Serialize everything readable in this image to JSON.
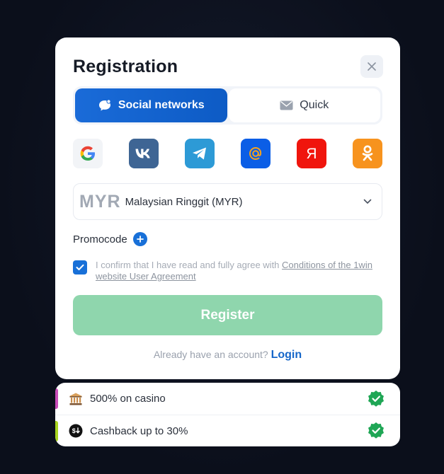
{
  "modal": {
    "title": "Registration",
    "tabs": [
      {
        "label": "Social networks",
        "icon": "chat-bubble-icon",
        "active": true
      },
      {
        "label": "Quick",
        "icon": "envelope-icon",
        "active": false
      }
    ],
    "social_providers": [
      {
        "name": "google-icon",
        "color": "#f2f4f7"
      },
      {
        "name": "vk-icon",
        "color": "#3e6594"
      },
      {
        "name": "telegram-icon",
        "color": "#2d9ad6"
      },
      {
        "name": "mail-at-icon",
        "color": "#0b5ee6"
      },
      {
        "name": "yandex-icon",
        "color": "#f0150d",
        "glyph": "Я"
      },
      {
        "name": "odnoklassniki-icon",
        "color": "#f7931e"
      }
    ],
    "currency": {
      "code": "MYR",
      "name": "Malaysian Ringgit (MYR)"
    },
    "promocode_label": "Promocode",
    "agreement": {
      "checked": true,
      "text": "I confirm that I have read and fully agree with ",
      "link": "Conditions of the 1win website User Agreement"
    },
    "register_label": "Register",
    "login_prompt": "Already have an account?",
    "login_link": "Login"
  },
  "bonuses": [
    {
      "text": "500% on casino",
      "icon": "bank-icon",
      "accent": "#c84bb8"
    },
    {
      "text": "Cashback up to 30%",
      "icon": "cashback-icon",
      "accent": "#a8d41e"
    }
  ],
  "colors": {
    "primary": "#1870d8",
    "register_disabled": "#8fd6ad",
    "verified_badge": "#1fa655",
    "background": "#0e1220"
  }
}
